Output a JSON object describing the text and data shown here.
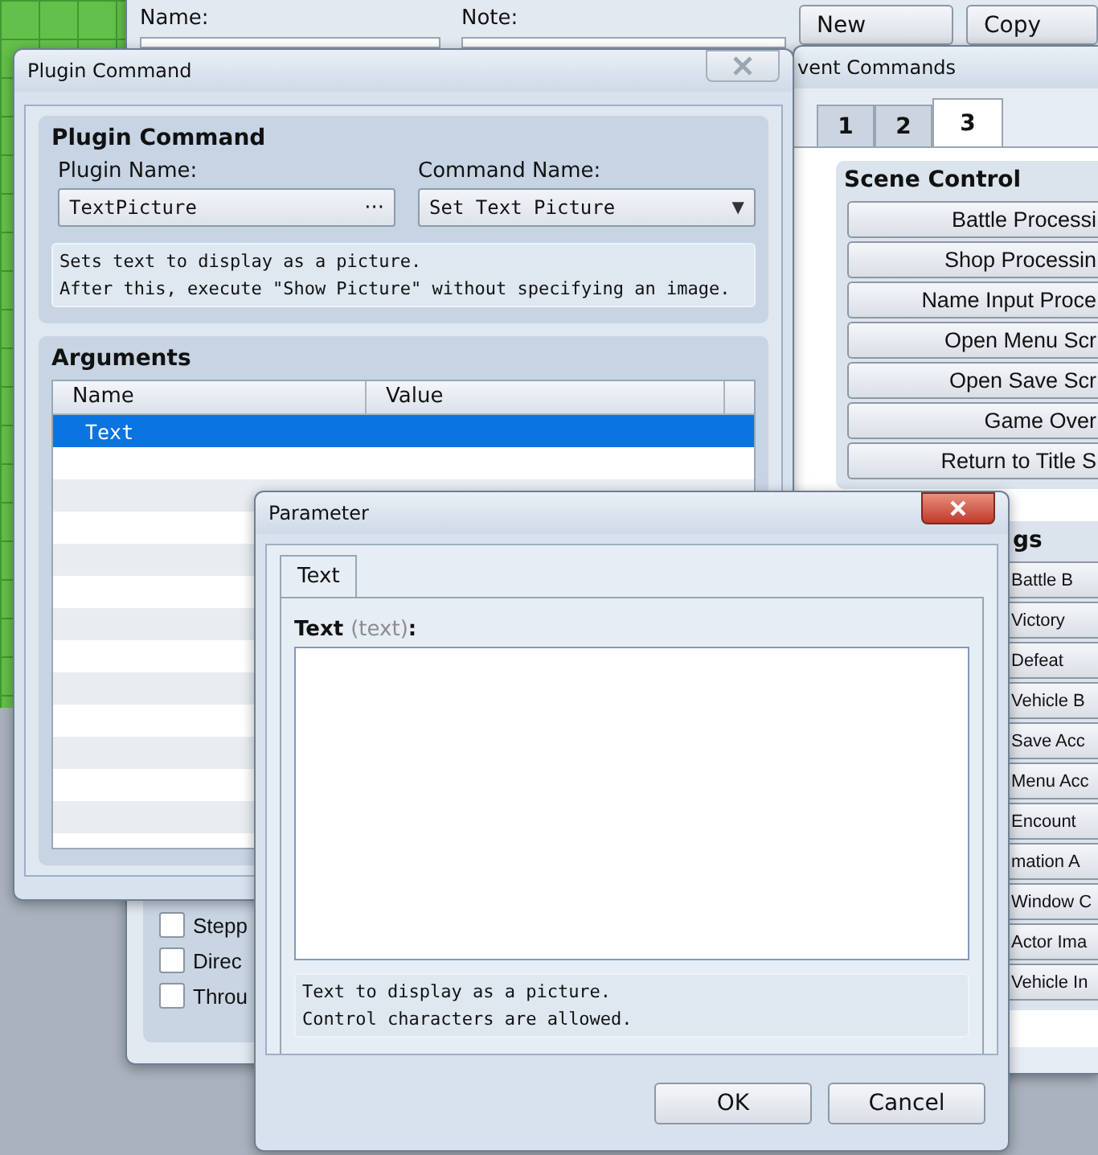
{
  "event_editor": {
    "name_label": "Name:",
    "note_label": "Note:",
    "buttons": [
      "New",
      "Copy"
    ],
    "options": [
      {
        "label": "Stepp",
        "checked": false
      },
      {
        "label": "Direc",
        "checked": false
      },
      {
        "label": "Throu",
        "checked": false
      }
    ]
  },
  "event_commands": {
    "title": "vent Commands",
    "tabs": [
      {
        "label": "1",
        "selected": false
      },
      {
        "label": "2",
        "selected": false
      },
      {
        "label": "3",
        "selected": true
      }
    ],
    "groups": [
      {
        "title": "Scene Control",
        "buttons": [
          "Battle Processi",
          "Shop Processin",
          "Name Input Proce",
          "Open Menu Scr",
          "Open Save Scr",
          "Game Over",
          "Return to Title S"
        ]
      },
      {
        "title": "gs",
        "buttons": [
          "Battle B",
          "Victory",
          "Defeat",
          "Vehicle B",
          "Save Acc",
          "Menu Acc",
          "Encount",
          "mation A",
          "Window C",
          "Actor Ima",
          "Vehicle In"
        ]
      }
    ]
  },
  "plugin_command": {
    "title": "Plugin Command",
    "group_title": "Plugin Command",
    "plugin_label": "Plugin Name:",
    "plugin_value": "TextPicture",
    "plugin_browse": "···",
    "command_label": "Command Name:",
    "command_value": "Set Text Picture",
    "command_caret": "▼",
    "description": [
      "Sets text to display as a picture.",
      "After this, execute \"Show Picture\" without specifying an image."
    ],
    "arguments": {
      "title": "Arguments",
      "columns": [
        "Name",
        "Value"
      ],
      "rows": [
        {
          "name": "Text",
          "selected": true
        }
      ]
    }
  },
  "parameter": {
    "title": "Parameter",
    "tabs": [
      {
        "label": "Text",
        "selected": true
      }
    ],
    "field_label": "Text",
    "field_key": "(text)",
    "field_colon": ":",
    "description": [
      "Text to display as a picture.",
      "Control characters are allowed."
    ],
    "buttons": [
      "OK",
      "Cancel"
    ]
  }
}
